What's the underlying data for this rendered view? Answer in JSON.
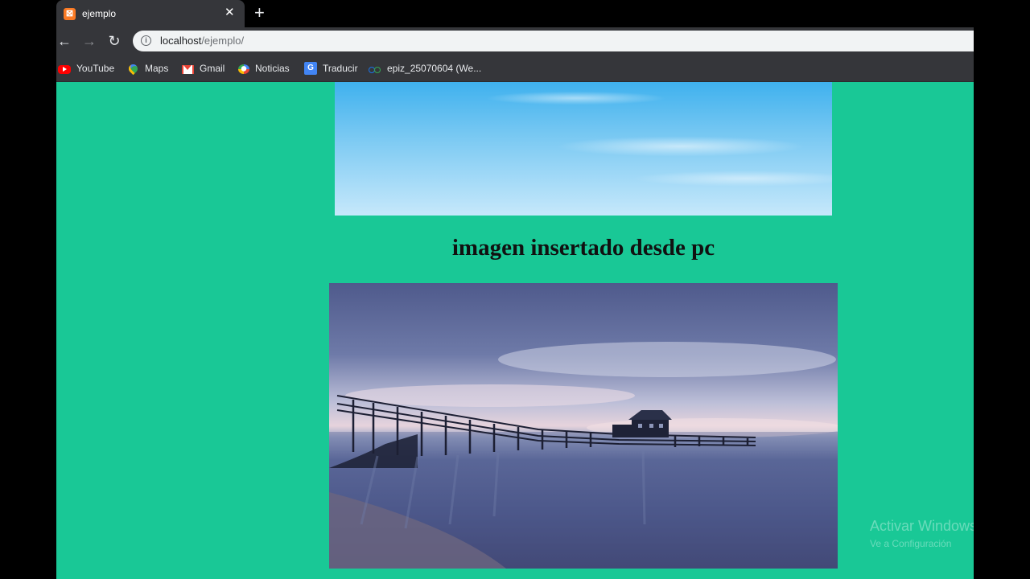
{
  "tab": {
    "title": "ejemplo",
    "close": "✕",
    "new_tab": "+"
  },
  "toolbar": {
    "back": "←",
    "forward": "→",
    "reload": "↻",
    "info": "i",
    "url_host": "localhost",
    "url_path": "/ejemplo/"
  },
  "bookmarks": {
    "items": [
      {
        "label": "YouTube",
        "icon": "youtube-icon"
      },
      {
        "label": "Maps",
        "icon": "maps-icon"
      },
      {
        "label": "Gmail",
        "icon": "gmail-icon"
      },
      {
        "label": "Noticias",
        "icon": "news-icon"
      },
      {
        "label": "Traducir",
        "icon": "translate-icon"
      },
      {
        "label": "epiz_25070604 (We...",
        "icon": "epiz-icon"
      }
    ]
  },
  "page": {
    "background": "#19c896",
    "heading": "imagen insertado desde pc"
  },
  "watermark": {
    "title": "Activar Windows",
    "subtitle": "Ve a Configuración"
  }
}
